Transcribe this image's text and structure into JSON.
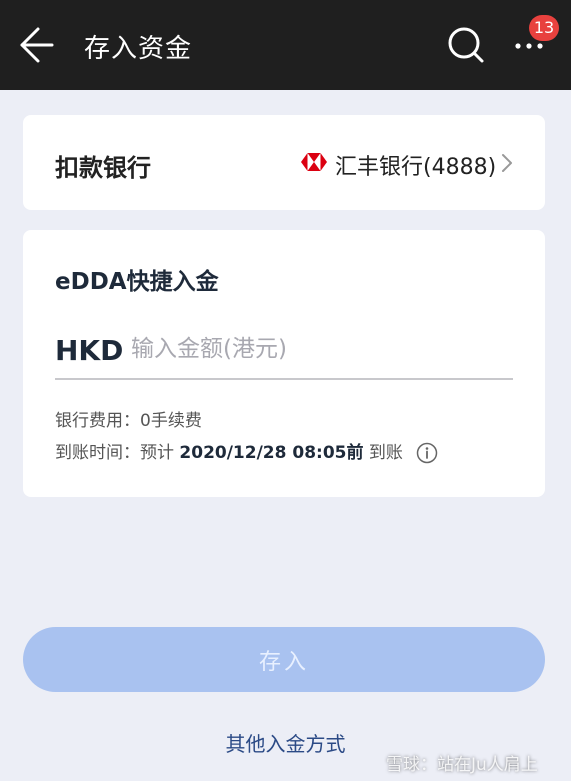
{
  "header": {
    "title": "存入资金",
    "notification_count": "13"
  },
  "bank_card": {
    "label": "扣款银行",
    "bank_name": "汇丰银行(4888)",
    "logo_color": "#db0011"
  },
  "edda_card": {
    "title": "eDDA快捷入金",
    "currency": "HKD",
    "amount_placeholder": "输入金额(港元)",
    "amount_value": "",
    "fee_label": "银行费用：",
    "fee_value": "0手续费",
    "time_label": "到账时间：",
    "time_prefix": "预计 ",
    "time_value": "2020/12/28 08:05前",
    "time_suffix": " 到账"
  },
  "actions": {
    "deposit_label": "存入",
    "other_methods_label": "其他入金方式"
  },
  "watermark": "雪球：站在Ju人肩上",
  "colors": {
    "topbar": "#1f1f1f",
    "badge": "#e8413e",
    "button_disabled": "#a9c2f0",
    "link": "#2b4a86"
  }
}
